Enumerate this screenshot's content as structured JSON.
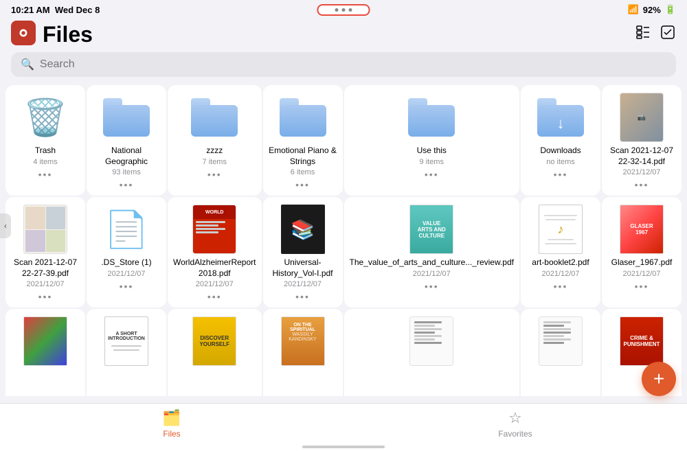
{
  "statusBar": {
    "time": "10:21 AM",
    "date": "Wed Dec 8",
    "wifi": "92%",
    "battery": "92%"
  },
  "header": {
    "title": "Files",
    "searchPlaceholder": "Search"
  },
  "dotsButton": {
    "label": "···"
  },
  "grid": {
    "row1": [
      {
        "id": "trash",
        "name": "Trash",
        "meta": "4 items",
        "type": "trash"
      },
      {
        "id": "national-geographic",
        "name": "National Geographic",
        "meta": "93 items",
        "type": "folder"
      },
      {
        "id": "zzzz",
        "name": "zzzz",
        "meta": "7 items",
        "type": "folder"
      },
      {
        "id": "emotional-piano",
        "name": "Emotional Piano & Strings",
        "meta": "6 items",
        "type": "folder"
      },
      {
        "id": "use-this",
        "name": "Use this",
        "meta": "9 items",
        "type": "folder"
      },
      {
        "id": "downloads",
        "name": "Downloads",
        "meta": "no items",
        "type": "folder-download"
      },
      {
        "id": "scan-2021-12-07-1",
        "name": "Scan 2021-12-07 22-32-14.pdf",
        "meta": "2021/12/07",
        "type": "photo"
      }
    ],
    "row2": [
      {
        "id": "scan-2021-12-07-2",
        "name": "Scan 2021-12-07 22-27-39.pdf",
        "meta": "2021/12/07",
        "type": "scan-grid"
      },
      {
        "id": "ds-store",
        "name": ".DS_Store (1)",
        "meta": "2021/12/07",
        "type": "doc"
      },
      {
        "id": "world-alzheimer",
        "name": "WorldAlzheimerReport 2018.pdf",
        "meta": "2021/12/07",
        "type": "pdf-red"
      },
      {
        "id": "universal-history",
        "name": "Universal-History_Vol-I.pdf",
        "meta": "2021/12/07",
        "type": "book-black"
      },
      {
        "id": "value-of-arts",
        "name": "The_value_of_arts_and_culture..._review.pdf",
        "meta": "2021/12/07",
        "type": "book-teal"
      },
      {
        "id": "art-booklet2",
        "name": "art-booklet2.pdf",
        "meta": "2021/12/07",
        "type": "pdf-white"
      },
      {
        "id": "glaser-1967",
        "name": "Glaser_1967.pdf",
        "meta": "2021/12/07",
        "type": "book-multicolor"
      }
    ],
    "row3": [
      {
        "id": "math-research",
        "name": "",
        "meta": "",
        "type": "book-colorful"
      },
      {
        "id": "short-intro",
        "name": "",
        "meta": "",
        "type": "book-white"
      },
      {
        "id": "discover-yourself",
        "name": "",
        "meta": "",
        "type": "book-yellow"
      },
      {
        "id": "wassily",
        "name": "",
        "meta": "",
        "type": "book-orange"
      },
      {
        "id": "blank1",
        "name": "",
        "meta": "",
        "type": "pdf-lined"
      },
      {
        "id": "blank2",
        "name": "",
        "meta": "",
        "type": "pdf-lined2"
      },
      {
        "id": "crime-punishment",
        "name": "",
        "meta": "",
        "type": "book-red2"
      }
    ]
  },
  "tabBar": {
    "tabs": [
      {
        "id": "files",
        "label": "Files",
        "icon": "📁",
        "active": true
      },
      {
        "id": "favorites",
        "label": "Favorites",
        "icon": "☆",
        "active": false
      }
    ]
  },
  "fab": {
    "label": "+"
  }
}
